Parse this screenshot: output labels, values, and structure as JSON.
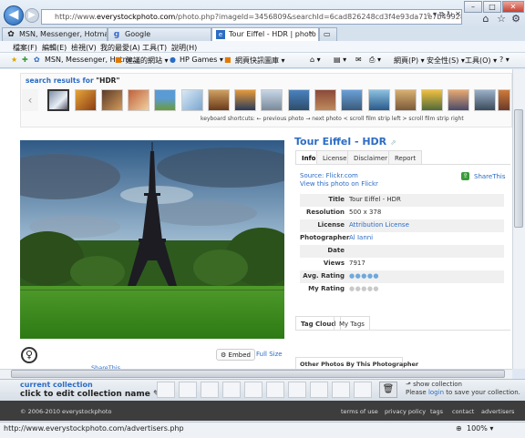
{
  "browser": {
    "url_prefix": "http://www.",
    "url_host": "everystockphoto.com",
    "url_rest": "/photo.php?imageId=3456809&searchId=6cad826248cd3f4e93da71e7b49928e3&npos=1&",
    "tabs": [
      {
        "label": "MSN, Messenger, Hotmail -..."
      },
      {
        "label": "Google"
      },
      {
        "label": "Tour Eiffel - HDR | photo ..."
      }
    ],
    "menu": [
      "檔案(F)",
      "編輯(E)",
      "檢視(V)",
      "我的最愛(A)",
      "工具(T)",
      "說明(H)"
    ],
    "favorites": [
      {
        "label": "MSN, Messenger, Hotm..."
      },
      {
        "label": "建議的網站 ▾"
      },
      {
        "label": "HP Games ▾"
      },
      {
        "label": "網頁快訊圖庫 ▾"
      }
    ],
    "command_bar": [
      "網頁(P) ▾",
      "安全性(S) ▾",
      "工具(O) ▾"
    ],
    "status_url": "http://www.everystockphoto.com/advertisers.php",
    "zoom": "100% ▾"
  },
  "search": {
    "label_prefix": "search results for ",
    "query": "\"HDR\"",
    "hint": "keyboard shortcuts: ← previous photo → next photo < scroll film strip left > scroll film strip right"
  },
  "photo": {
    "title": "Tour Eiffel - HDR",
    "title_ext": "⇗",
    "tabs": [
      "Info",
      "License",
      "Disclaimer",
      "Report"
    ],
    "source": "Source: Flickr.com",
    "view_link": "View this photo on Flickr",
    "share": "ShareThis",
    "rows": [
      {
        "k": "Title",
        "v": "Tour Eiffel - HDR"
      },
      {
        "k": "Resolution",
        "v": "500 x 378"
      },
      {
        "k": "License",
        "v": "Attribution License"
      },
      {
        "k": "Photographer",
        "v": "Al Ianni"
      },
      {
        "k": "Date",
        "v": ""
      },
      {
        "k": "Views",
        "v": "7917"
      },
      {
        "k": "Avg. Rating",
        "v": "●●●●●"
      },
      {
        "k": "My Rating",
        "v": "●●●●●"
      }
    ],
    "cloud_tabs": [
      "Tag Cloud",
      "My Tags"
    ],
    "other": "Other Photos By This Photographer",
    "embed": "Embed",
    "full_size": "Full Size",
    "share2": "ShareThis"
  },
  "collection": {
    "title": "current collection",
    "edit": "click to edit collection name",
    "show": "show collection",
    "login_pre": "Please ",
    "login_link": "login",
    "login_post": " to save your collection."
  },
  "footer": {
    "copyright": "© 2006-2010 everystockphoto",
    "links": [
      "terms of use",
      "privacy policy",
      "tags",
      "contact",
      "advertisers"
    ]
  },
  "colors": {
    "link": "#2b6cc4",
    "footer": "#3d3d3d"
  }
}
